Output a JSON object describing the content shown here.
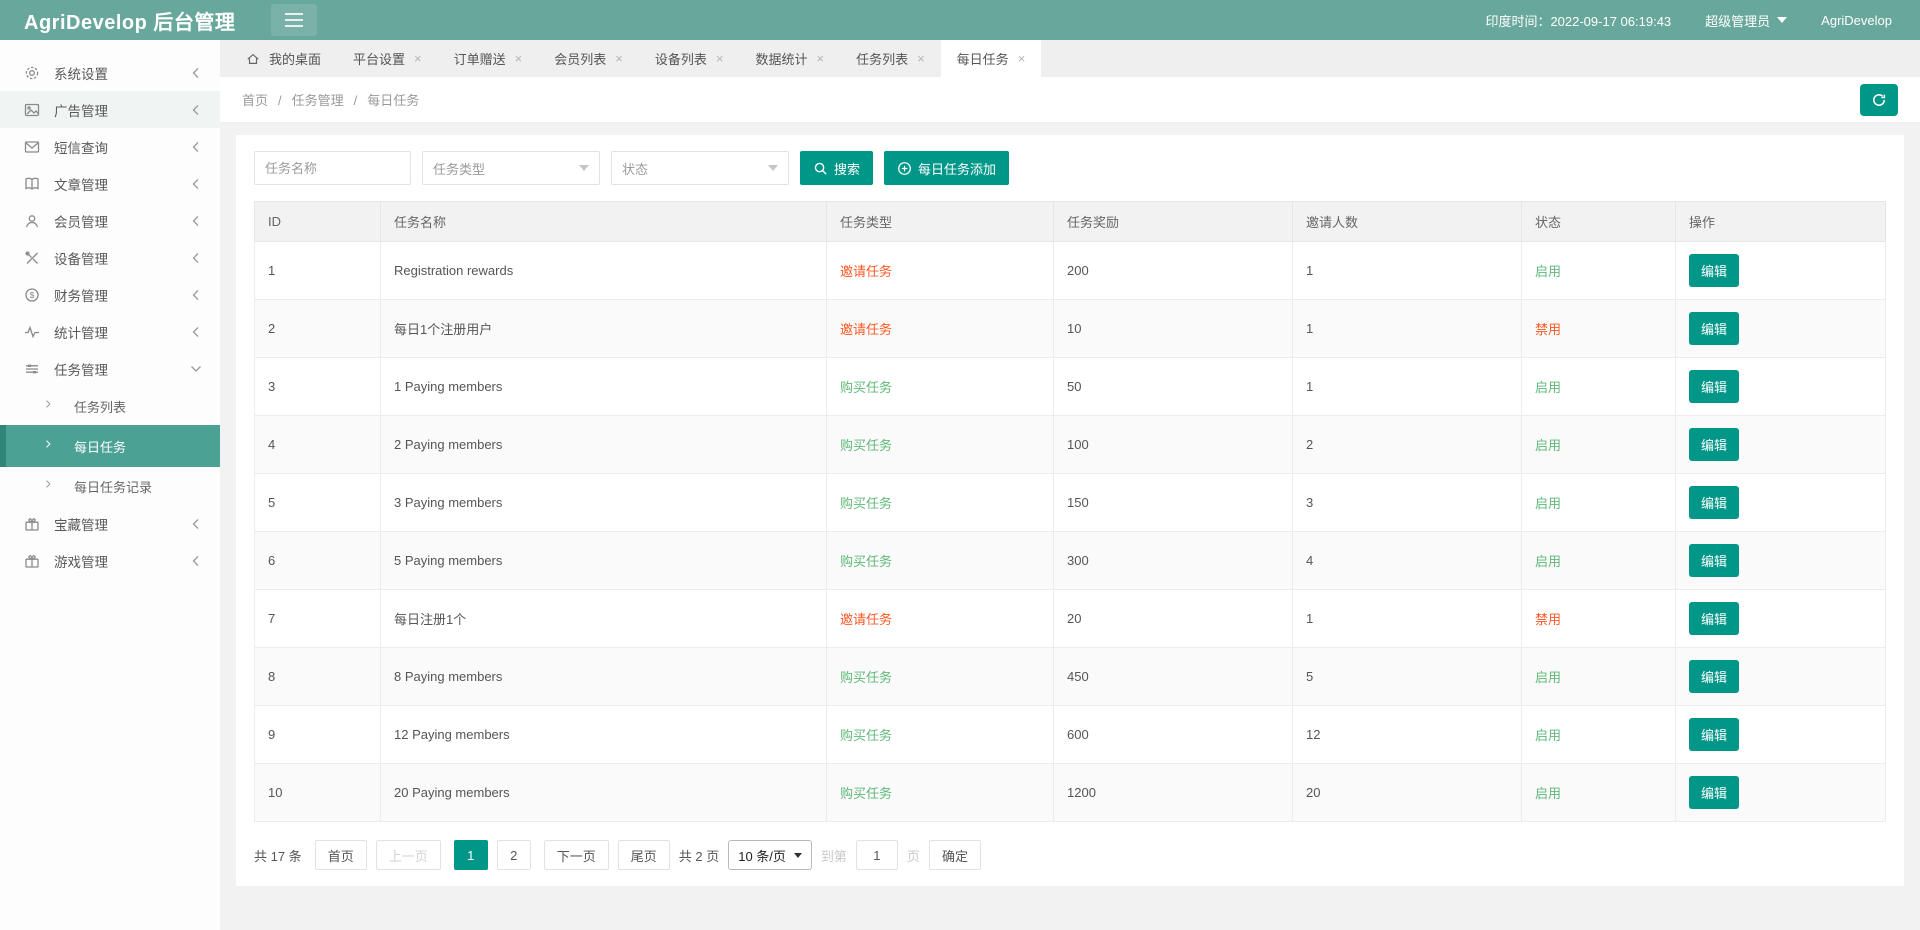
{
  "header": {
    "title": "AgriDevelop 后台管理",
    "time": "印度时间：2022-09-17 06:19:43",
    "role": "超级管理员",
    "brand": "AgriDevelop"
  },
  "sidebar": {
    "items": [
      {
        "id": "system",
        "icon": "gear-icon",
        "label": "系统设置",
        "chevron": "left"
      },
      {
        "id": "ads",
        "icon": "image-icon",
        "label": "广告管理",
        "chevron": "left",
        "highlight": true
      },
      {
        "id": "sms",
        "icon": "envelope-icon",
        "label": "短信查询",
        "chevron": "left"
      },
      {
        "id": "articles",
        "icon": "book-icon",
        "label": "文章管理",
        "chevron": "left"
      },
      {
        "id": "members",
        "icon": "user-icon",
        "label": "会员管理",
        "chevron": "left"
      },
      {
        "id": "devices",
        "icon": "tools-icon",
        "label": "设备管理",
        "chevron": "left"
      },
      {
        "id": "finance",
        "icon": "dollar-icon",
        "label": "财务管理",
        "chevron": "left"
      },
      {
        "id": "stats",
        "icon": "pulse-icon",
        "label": "统计管理",
        "chevron": "left"
      },
      {
        "id": "tasks",
        "icon": "sliders-icon",
        "label": "任务管理",
        "chevron": "down",
        "expanded": true,
        "children": [
          {
            "id": "task-list",
            "label": "任务列表",
            "active": false
          },
          {
            "id": "daily-task",
            "label": "每日任务",
            "active": true
          },
          {
            "id": "daily-task-log",
            "label": "每日任务记录",
            "active": false
          }
        ]
      },
      {
        "id": "treasure",
        "icon": "gift-icon",
        "label": "宝藏管理",
        "chevron": "left"
      },
      {
        "id": "games",
        "icon": "gift-icon",
        "label": "游戏管理",
        "chevron": "left"
      }
    ]
  },
  "tabs": [
    {
      "id": "desktop",
      "label": "我的桌面",
      "home": true,
      "closable": false,
      "active": false
    },
    {
      "id": "platform",
      "label": "平台设置",
      "closable": true,
      "active": false
    },
    {
      "id": "order-gift",
      "label": "订单赠送",
      "closable": true,
      "active": false
    },
    {
      "id": "members",
      "label": "会员列表",
      "closable": true,
      "active": false
    },
    {
      "id": "devices",
      "label": "设备列表",
      "closable": true,
      "active": false
    },
    {
      "id": "stats",
      "label": "数据统计",
      "closable": true,
      "active": false
    },
    {
      "id": "task-list",
      "label": "任务列表",
      "closable": true,
      "active": false
    },
    {
      "id": "daily-task",
      "label": "每日任务",
      "closable": true,
      "active": true
    }
  ],
  "breadcrumb": {
    "items": [
      "首页",
      "任务管理",
      "每日任务"
    ],
    "separator": "/"
  },
  "filters": {
    "name_placeholder": "任务名称",
    "type_placeholder": "任务类型",
    "status_placeholder": "状态",
    "search_label": "搜索",
    "add_label": "每日任务添加"
  },
  "table": {
    "columns": [
      "ID",
      "任务名称",
      "任务类型",
      "任务奖励",
      "邀请人数",
      "状态",
      "操作"
    ],
    "edit_label": "编辑",
    "rows": [
      {
        "id": "1",
        "name": "Registration rewards",
        "type": "邀请任务",
        "type_color": "red",
        "reward": "200",
        "invites": "1",
        "status": "启用",
        "status_color": "green"
      },
      {
        "id": "2",
        "name": "每日1个注册用户",
        "type": "邀请任务",
        "type_color": "red",
        "reward": "10",
        "invites": "1",
        "status": "禁用",
        "status_color": "red"
      },
      {
        "id": "3",
        "name": "1 Paying members",
        "type": "购买任务",
        "type_color": "green",
        "reward": "50",
        "invites": "1",
        "status": "启用",
        "status_color": "green"
      },
      {
        "id": "4",
        "name": "2 Paying members",
        "type": "购买任务",
        "type_color": "green",
        "reward": "100",
        "invites": "2",
        "status": "启用",
        "status_color": "green"
      },
      {
        "id": "5",
        "name": "3 Paying members",
        "type": "购买任务",
        "type_color": "green",
        "reward": "150",
        "invites": "3",
        "status": "启用",
        "status_color": "green"
      },
      {
        "id": "6",
        "name": "5 Paying members",
        "type": "购买任务",
        "type_color": "green",
        "reward": "300",
        "invites": "4",
        "status": "启用",
        "status_color": "green"
      },
      {
        "id": "7",
        "name": "每日注册1个",
        "type": "邀请任务",
        "type_color": "red",
        "reward": "20",
        "invites": "1",
        "status": "禁用",
        "status_color": "red"
      },
      {
        "id": "8",
        "name": "8 Paying members",
        "type": "购买任务",
        "type_color": "green",
        "reward": "450",
        "invites": "5",
        "status": "启用",
        "status_color": "green"
      },
      {
        "id": "9",
        "name": "12 Paying members",
        "type": "购买任务",
        "type_color": "green",
        "reward": "600",
        "invites": "12",
        "status": "启用",
        "status_color": "green"
      },
      {
        "id": "10",
        "name": "20 Paying members",
        "type": "购买任务",
        "type_color": "green",
        "reward": "1200",
        "invites": "20",
        "status": "启用",
        "status_color": "green"
      }
    ]
  },
  "pagination": {
    "total": "共 17 条",
    "first": "首页",
    "prev": "上一页",
    "pages": [
      "1",
      "2"
    ],
    "current": "1",
    "next": "下一页",
    "last": "尾页",
    "total_pages": "共 2 页",
    "page_size": "10 条/页",
    "goto_prefix": "到第",
    "goto_value": "1",
    "goto_suffix": "页",
    "confirm": "确定"
  },
  "colors": {
    "header_bg": "#68a79c",
    "accent": "#009688",
    "red": "#ff5722",
    "green": "#5fb878",
    "sidebar_active_bg": "#4aa194"
  }
}
